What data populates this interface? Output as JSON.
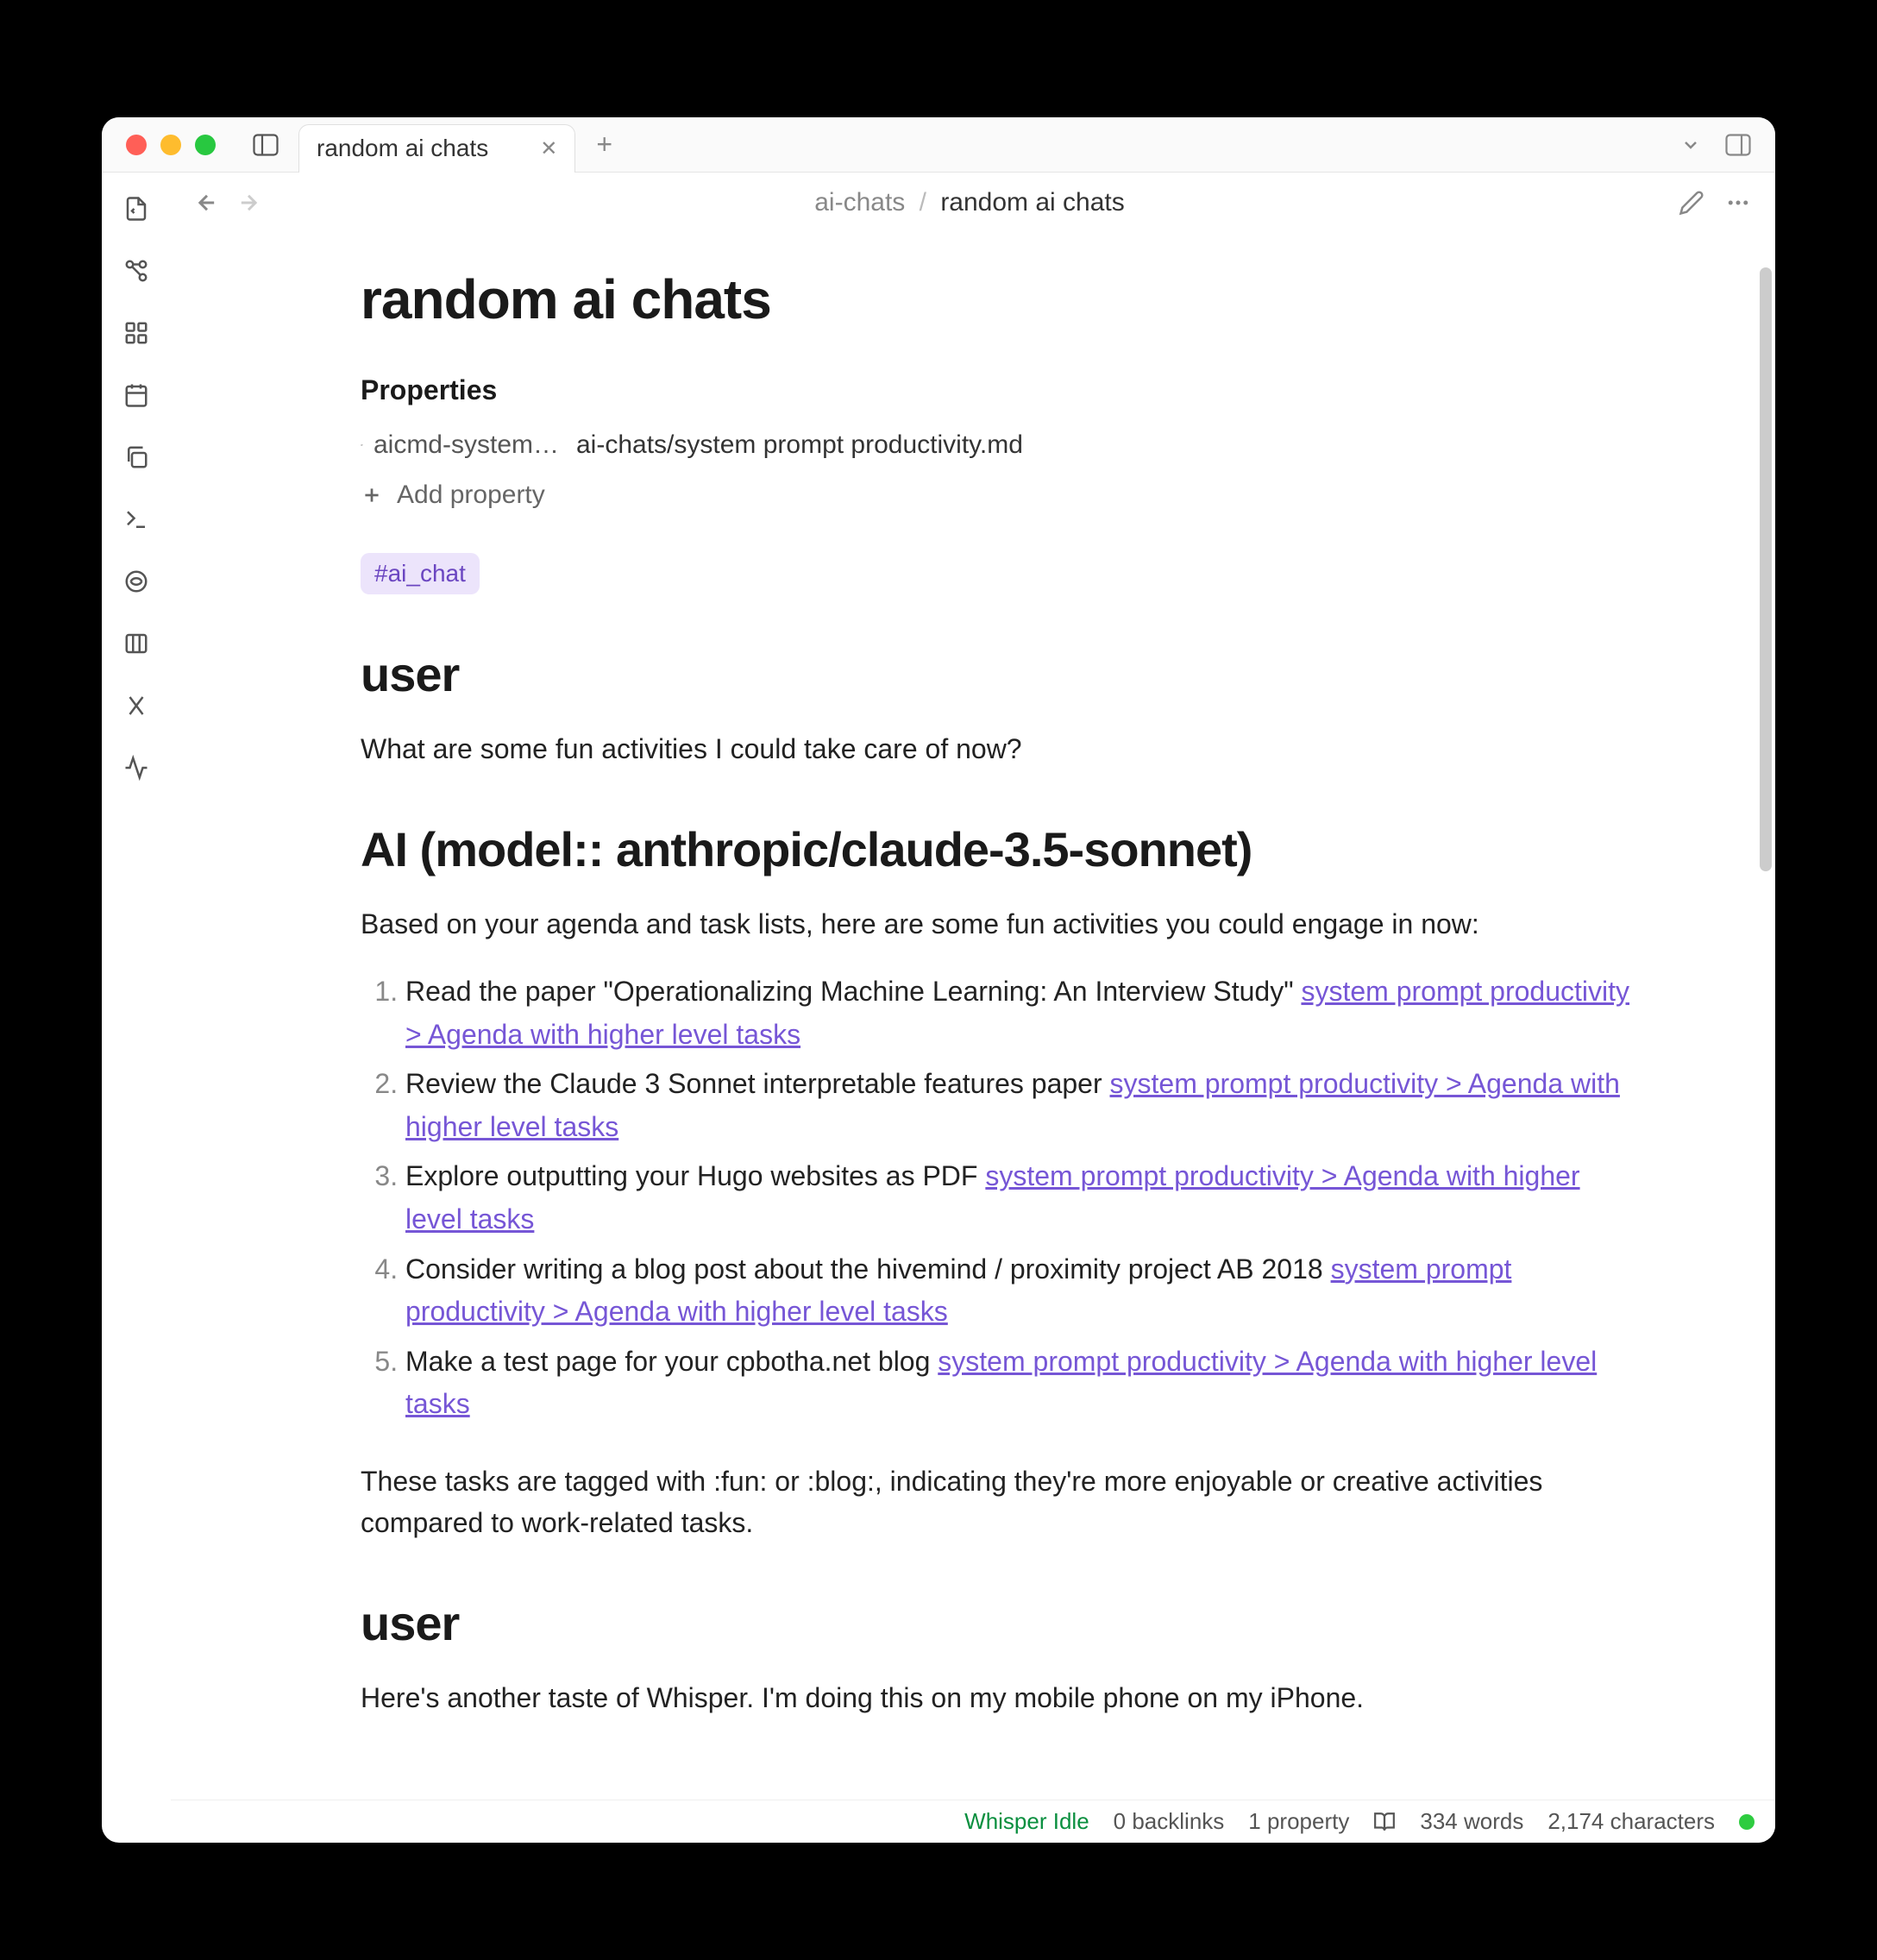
{
  "window": {
    "tab_title": "random ai chats"
  },
  "breadcrumb": {
    "parent": "ai-chats",
    "current": "random ai chats"
  },
  "page": {
    "title": "random ai chats",
    "properties_heading": "Properties",
    "property_key": "aicmd-system…",
    "property_value": "ai-chats/system prompt productivity.md",
    "add_property_label": "Add property",
    "tag": "#ai_chat"
  },
  "sections": {
    "user1_heading": "user",
    "user1_body": "What are some fun activities I could take care of now?",
    "ai_heading": "AI (model:: anthropic/claude-3.5-sonnet)",
    "ai_intro": "Based on your agenda and task lists, here are some fun activities you could engage in now:",
    "tasks": [
      {
        "text": "Read the paper \"Operationalizing Machine Learning: An Interview Study\" ",
        "link": "system prompt productivity > Agenda with higher level tasks"
      },
      {
        "text": "Review the Claude 3 Sonnet interpretable features paper ",
        "link": "system prompt productivity > Agenda with higher level tasks"
      },
      {
        "text": "Explore outputting your Hugo websites as PDF ",
        "link": "system prompt productivity > Agenda with higher level tasks"
      },
      {
        "text": "Consider writing a blog post about the hivemind / proximity project AB 2018 ",
        "link": "system prompt productivity > Agenda with higher level tasks"
      },
      {
        "text": "Make a test page for your cpbotha.net blog ",
        "link": "system prompt productivity > Agenda with higher level tasks"
      }
    ],
    "ai_outro": "These tasks are tagged with :fun: or :blog:, indicating they're more enjoyable or creative activities compared to work-related tasks.",
    "user2_heading": "user",
    "user2_body": "Here's another taste of Whisper. I'm doing this on my mobile phone on my iPhone."
  },
  "statusbar": {
    "whisper": "Whisper Idle",
    "backlinks": "0 backlinks",
    "properties": "1 property",
    "words": "334 words",
    "chars": "2,174 characters"
  }
}
